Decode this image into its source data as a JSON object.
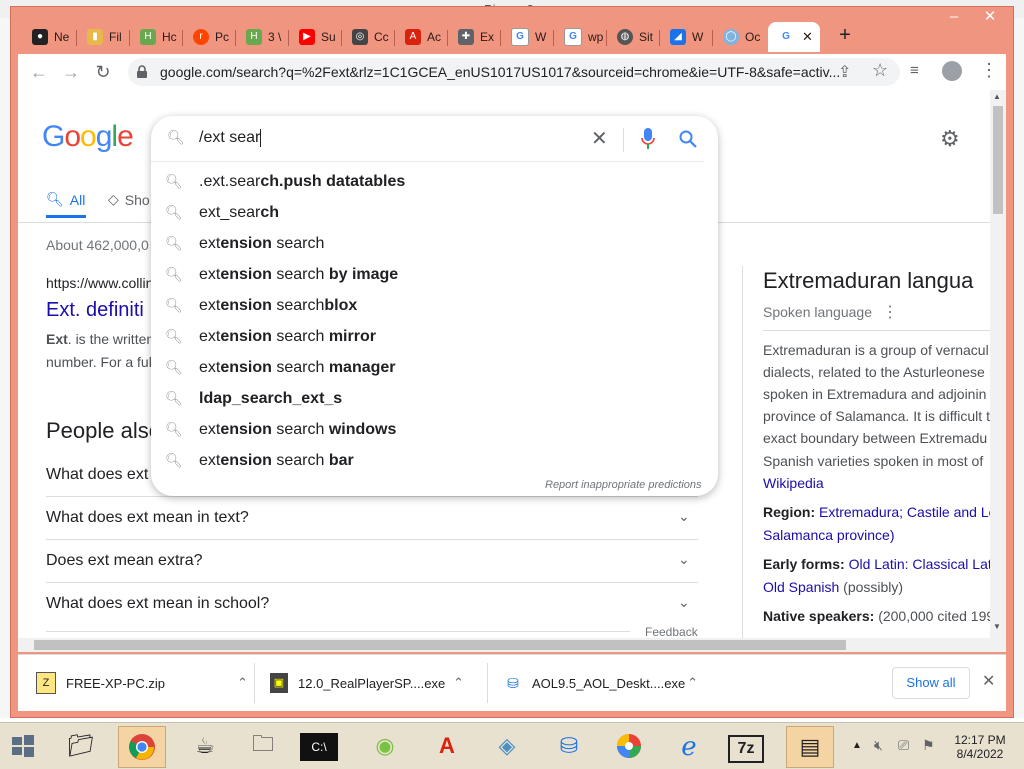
{
  "background_window": {
    "title": "Picasa 3"
  },
  "window": {
    "controls": {
      "minimize": "–",
      "maximize": "❐",
      "close": "✕"
    }
  },
  "tabs": [
    {
      "label": "Ne",
      "icon": "github-icon"
    },
    {
      "label": "Fil",
      "icon": "folder-icon"
    },
    {
      "label": "Hc",
      "icon": "hb-icon"
    },
    {
      "label": "Pc",
      "icon": "reddit-icon"
    },
    {
      "label": "3 \\",
      "icon": "hb-icon"
    },
    {
      "label": "Su",
      "icon": "youtube-icon"
    },
    {
      "label": "Cc",
      "icon": "cc-icon"
    },
    {
      "label": "Ac",
      "icon": "adobe-icon"
    },
    {
      "label": "Ex",
      "icon": "puzzle-icon"
    },
    {
      "label": "W",
      "icon": "google-icon"
    },
    {
      "label": "wp",
      "icon": "google-icon"
    },
    {
      "label": "Sit",
      "icon": "globe-icon"
    },
    {
      "label": "W",
      "icon": "shark-icon"
    },
    {
      "label": "Oc",
      "icon": "disc-icon"
    },
    {
      "label": "",
      "icon": "google-icon",
      "active": true,
      "close": "✕"
    }
  ],
  "new_tab": "+",
  "toolbar": {
    "back": "←",
    "forward": "→",
    "reload": "↻",
    "url": "google.com/search?q=%2Fext&rlz=1C1GCEA_enUS1017US1017&sourceid=chrome&ie=UTF-8&safe=activ...",
    "share": "⇪",
    "star": "☆",
    "menu": "⋮"
  },
  "google": {
    "logo": [
      "G",
      "o",
      "o",
      "g",
      "l",
      "e"
    ],
    "search_query": "/ext sear",
    "clear": "✕",
    "tabs": {
      "all": "All",
      "shopping": "Sho"
    },
    "result_stats": "About 462,000,0",
    "result": {
      "url": "https://www.collin",
      "title": "Ext. definiti",
      "snippet_1a": "Ext",
      "snippet_1b": ". is the written",
      "snippet_2": "number. For a ful"
    },
    "people_also_ask": {
      "heading": "People also",
      "questions": [
        "What does ext",
        "What does ext mean in text?",
        "Does ext mean extra?",
        "What does ext mean in school?"
      ],
      "feedback": "Feedback"
    },
    "suggestions": [
      {
        "plain": ".ext.sear",
        "bold": "ch.push datatables"
      },
      {
        "plain": "ext_sear",
        "bold": "ch"
      },
      {
        "plain": "ext",
        "bold": "ension",
        "rest_plain": " search",
        "rest_bold": ""
      },
      {
        "plain": "ext",
        "bold": "ension",
        "rest_plain": " search",
        "rest_bold": " by image"
      },
      {
        "plain": "ext",
        "bold": "ension",
        "rest_plain": " search",
        "rest_bold": "blox"
      },
      {
        "plain": "ext",
        "bold": "ension",
        "rest_plain": " search",
        "rest_bold": " mirror"
      },
      {
        "plain": "ext",
        "bold": "ension",
        "rest_plain": " search",
        "rest_bold": " manager"
      },
      {
        "plain": "",
        "bold": "ldap_search_ext_s"
      },
      {
        "plain": "ext",
        "bold": "ension",
        "rest_plain": " search",
        "rest_bold": " windows"
      },
      {
        "plain": "ext",
        "bold": "ension",
        "rest_plain": " search",
        "rest_bold": " bar"
      }
    ],
    "report_predictions": "Report inappropriate predictions",
    "knowledge_panel": {
      "title": "Extremaduran langua",
      "subtitle": "Spoken language",
      "description": [
        "Extremaduran is a group of vernacul",
        "dialects, related to the Asturleonese",
        "spoken in Extremadura and adjoinin",
        "province of Salamanca. It is difficult t",
        "exact boundary between Extremadu",
        "Spanish varieties spoken in most of"
      ],
      "source": "Wikipedia",
      "region_label": "Region: ",
      "region_value": "Extremadura; Castile and Le",
      "region_value_2": "Salamanca province)",
      "early_forms_label": "Early forms: ",
      "early_forms_value": "Old Latin: Classical Lati",
      "early_forms_value_2a": "Old Spanish",
      "early_forms_value_2b": " (possibly)",
      "native_speakers_label": "Native speakers: ",
      "native_speakers_value": "(200,000 cited 199"
    }
  },
  "downloads": {
    "items": [
      "FREE-XP-PC.zip",
      "12.0_RealPlayerSP....exe",
      "AOL9.5_AOL_Deskt....exe"
    ],
    "show_all": "Show all",
    "close": "✕"
  },
  "taskbar": {
    "time": "12:17 PM",
    "date": "8/4/2022"
  }
}
